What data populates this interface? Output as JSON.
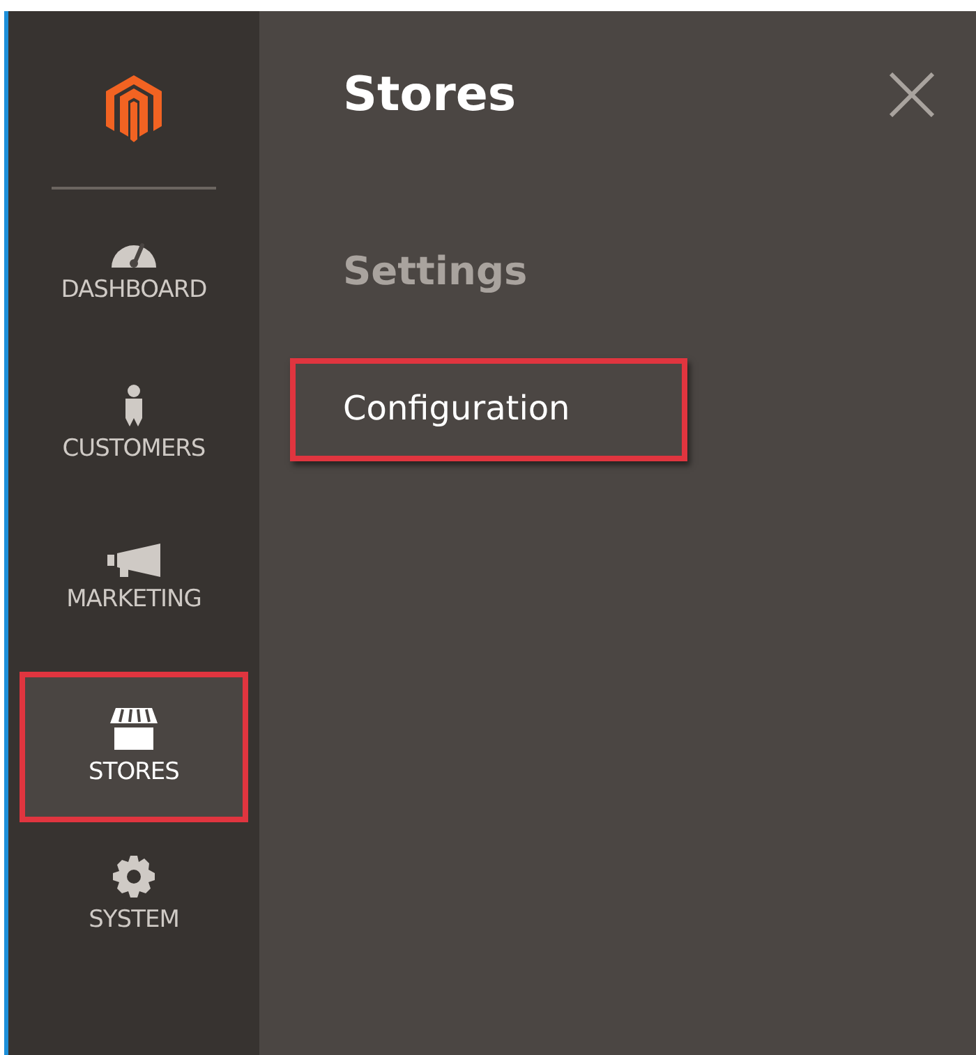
{
  "sidebar": {
    "items": [
      {
        "label": "DASHBOARD",
        "selected": false,
        "highlighted": false
      },
      {
        "label": "CUSTOMERS",
        "selected": false,
        "highlighted": false
      },
      {
        "label": "MARKETING",
        "selected": false,
        "highlighted": false
      },
      {
        "label": "STORES",
        "selected": true,
        "highlighted": true
      },
      {
        "label": "SYSTEM",
        "selected": false,
        "highlighted": false
      }
    ]
  },
  "panel": {
    "title": "Stores",
    "sections": [
      {
        "heading": "Settings",
        "links": [
          {
            "label": "Configuration",
            "highlighted": true
          }
        ]
      }
    ]
  }
}
